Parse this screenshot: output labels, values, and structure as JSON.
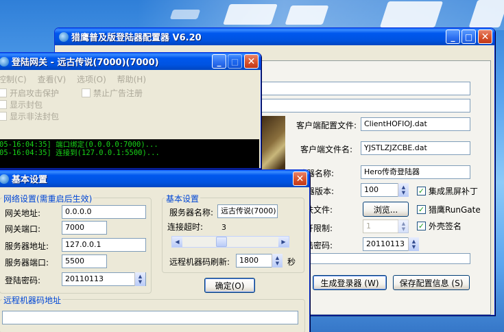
{
  "main_window": {
    "title": "猎鹰普及版登陆器配置器 V6.20",
    "labels": {
      "client_config_file": "客户端配置文件:",
      "client_file_name": "客户端文件名:",
      "launcher_name": "陆器名称:",
      "launcher_version": "陆器版本:",
      "skin_file": "肤文件:",
      "open_limit": "开限制:",
      "login_password": "陆密码:"
    },
    "values": {
      "client_config_file": "ClientHOFIOJ.dat",
      "client_file_name": "YJSTLZJZCBE.dat",
      "launcher_name": "Hero传奇登陆器",
      "launcher_version": "100",
      "open_limit": "1",
      "login_password": "20110113"
    },
    "checkboxes": {
      "black_screen_patch": "集成黑屏补丁",
      "falcon_rungate": "猎鹰RunGate",
      "shell_sign": "外壳签名"
    },
    "buttons": {
      "browse": "浏览...",
      "generate": "生成登录器 (W)",
      "save_config": "保存配置信息 (S)"
    }
  },
  "gateway_window": {
    "title": "登陆网关 - 远古传说(7000)(7000)",
    "menu": [
      "控制(C)",
      "查看(V)",
      "选项(O)",
      "帮助(H)"
    ],
    "checkboxes": {
      "attack_protect": "开启攻击保护",
      "block_ads": "禁止广告注册",
      "show_packets": "显示封包",
      "show_illegal": "显示非法封包"
    },
    "log": [
      "05-16:04:35] 端口绑定(0.0.0.0:7000)...",
      "05-16:04:35] 连接到(127.0.0.1:5500)..."
    ]
  },
  "settings_dialog": {
    "title": "基本设置",
    "network_group": "网络设置(需重启后生效)",
    "network": {
      "gateway_address": {
        "label": "网关地址:",
        "value": "0.0.0.0"
      },
      "gateway_port": {
        "label": "网关端口:",
        "value": "7000"
      },
      "server_address": {
        "label": "服务器地址:",
        "value": "127.0.0.1"
      },
      "server_port": {
        "label": "服务器端口:",
        "value": "5500"
      },
      "login_password": {
        "label": "登陆密码:",
        "value": "20110113"
      }
    },
    "basic_group": "基本设置",
    "basic": {
      "server_name": {
        "label": "服务器名称:",
        "value": "远古传说(7000)"
      },
      "timeout": {
        "label": "连接超时:",
        "value": "3"
      },
      "refresh": {
        "label": "远程机器码刷新:",
        "value": "1800",
        "unit": "秒"
      }
    },
    "ok_button": "确定(O)",
    "remote_group": "远程机器码地址"
  }
}
